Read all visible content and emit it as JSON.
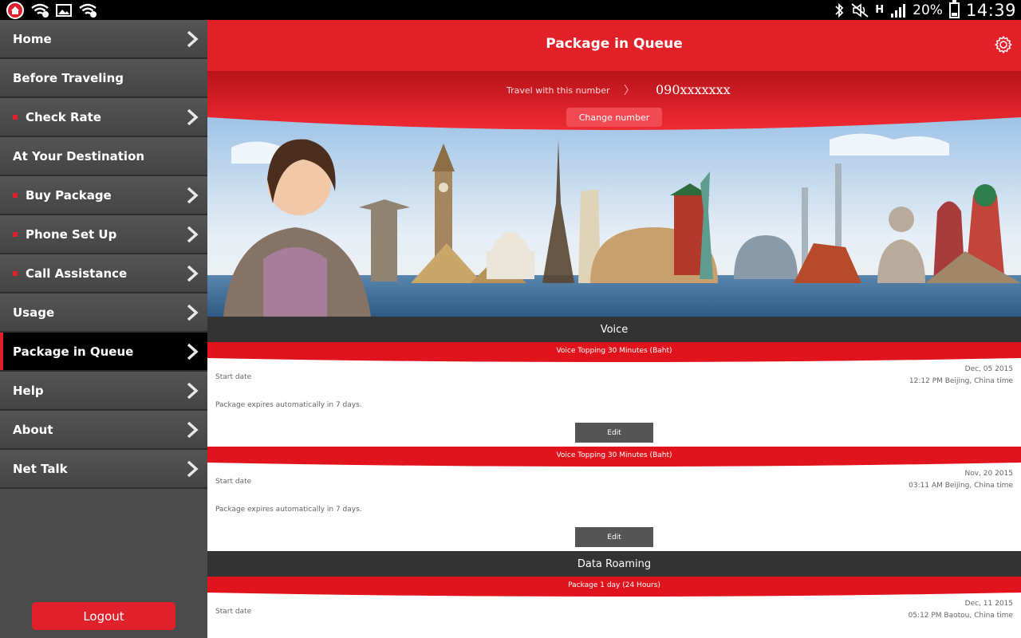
{
  "status_bar": {
    "battery": "20%",
    "network": "H",
    "time": "14:39",
    "icons": [
      "app-home-icon",
      "wifi-question-icon",
      "image-icon",
      "wifi-question-icon",
      "bluetooth-icon",
      "mute-icon",
      "signal-icon",
      "battery-icon"
    ]
  },
  "sidebar": {
    "items": [
      {
        "label": "Home",
        "bullet": false,
        "chevron": true,
        "active": false
      },
      {
        "label": "Before Traveling",
        "bullet": false,
        "chevron": false,
        "active": false
      },
      {
        "label": "Check Rate",
        "bullet": true,
        "chevron": true,
        "active": false
      },
      {
        "label": "At Your Destination",
        "bullet": false,
        "chevron": false,
        "active": false
      },
      {
        "label": "Buy Package",
        "bullet": true,
        "chevron": true,
        "active": false
      },
      {
        "label": "Phone Set Up",
        "bullet": true,
        "chevron": true,
        "active": false
      },
      {
        "label": "Call Assistance",
        "bullet": true,
        "chevron": true,
        "active": false
      },
      {
        "label": "Usage",
        "bullet": false,
        "chevron": true,
        "active": false
      },
      {
        "label": "Package in Queue",
        "bullet": false,
        "chevron": true,
        "active": true
      },
      {
        "label": "Help",
        "bullet": false,
        "chevron": true,
        "active": false
      },
      {
        "label": "About",
        "bullet": false,
        "chevron": true,
        "active": false
      },
      {
        "label": "Net Talk",
        "bullet": false,
        "chevron": true,
        "active": false
      }
    ],
    "logout_label": "Logout"
  },
  "header": {
    "title": "Package in Queue",
    "settings_icon": "gear-icon"
  },
  "travel_number": {
    "label": "Travel with this number",
    "separator": "〉",
    "number": "090xxxxxxx",
    "change_label": "Change number"
  },
  "voice": {
    "section_title": "Voice",
    "packages": [
      {
        "name": "Voice Topping 30 Minutes (Baht)",
        "start_label": "Start date",
        "date": "Dec, 05 2015",
        "time": "12:12 PM  Beijing, China time",
        "expiry": "Package expires automatically in 7 days.",
        "edit_label": "Edit"
      },
      {
        "name": "Voice Topping 30 Minutes (Baht)",
        "start_label": "Start date",
        "date": "Nov, 20 2015",
        "time": "03:11 AM  Beijing, China time",
        "expiry": "Package expires automatically in 7 days.",
        "edit_label": "Edit"
      }
    ]
  },
  "data_roaming": {
    "section_title": "Data Roaming",
    "packages": [
      {
        "name": "Package 1 day (24 Hours)",
        "start_label": "Start date",
        "date": "Dec, 11 2015",
        "time": "05:12 PM  Baotou, China time"
      }
    ]
  },
  "colors": {
    "accent_red": "#e22028",
    "sidebar_bg": "#4b4b4b",
    "section_bg": "#333333"
  }
}
